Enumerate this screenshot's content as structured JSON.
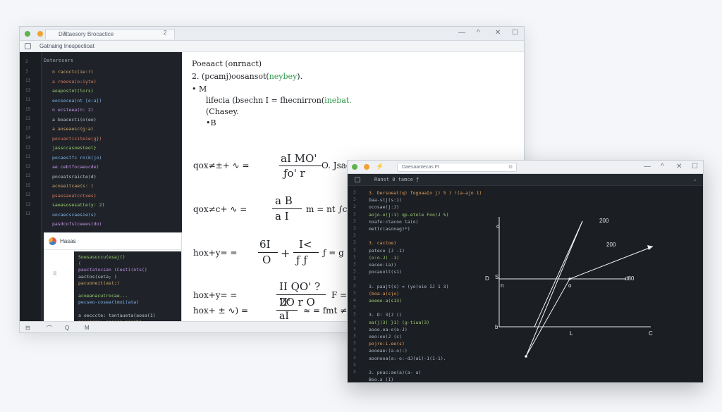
{
  "window1": {
    "tab_title": "Dattaesory Brocactice",
    "tab_close": "x",
    "tab_number": "2",
    "toolbar_text": "Gatnaing Inespectioat",
    "controls": {
      "minimize": "—",
      "restore": "^",
      "close": "✕",
      "maximize": "☐"
    },
    "editor_header": "Daterosers",
    "line_numbers": [
      "2",
      "3",
      "13",
      "13",
      "11",
      "15",
      "13",
      "17",
      "14",
      "13",
      "11",
      "12",
      "13",
      "15",
      "12",
      "13",
      "11"
    ],
    "code_lines": [
      "n racoctc(ie:r)",
      "a roeosa(o:iyte)",
      "aoapostnt(lors)",
      "eocsecea(nt [o:a])",
      "n ecsteea(n: 2)",
      "a boacecti(o(eo)",
      "a aoseaesc(g:a)",
      "pocuacticiteie(g})",
      "jassccasoesteol}",
      "pocaestfc ro(k(jo)",
      "ae cebtfocaeucde)",
      "pnceatsraicte(d)",
      "acoseitcae(s: )",
      "psassaoatcctxes)",
      "saeasosesatte(y: 2)",
      "uocaecscaesie(s)",
      "pasdcofstceees(do)"
    ],
    "notes": {
      "title": "Hasas",
      "side_glyph": "!!!",
      "code_lines": [
        "Soesasuccu(esaj()",
        "(",
        "pauctatocsan (Cesti(nts()",
        "aactos(seta; )",
        "pacuoneit(ast;)",
        "",
        "acoeanacutrocae...",
        "pecseo-cosea(tmoi(ata)",
        "",
        "a oecccte: tantaueta(aosa(1)",
        "psasecan: eaocca asa(b)",
        "aocteae:-ean-aoeae(c(os)",
        "peccsessa(e)",
        "",
        "pc--as-a-icc(o;. a)"
      ]
    },
    "math": {
      "line1": "Poeaact (onrnact)",
      "line2_prefix": "2. (pcamj)oosansot(",
      "line2_green": "neybey",
      "line2_suffix": ").",
      "bullet1": "•   M",
      "line3_prefix": "lifecia (bsechn I = fhecnirron(",
      "line3_green": "inebat.",
      "line4": "(Chasey.",
      "bullet2": "•B",
      "eq1": {
        "lhs": "qox≠±+ ∿ =",
        "num": "aI MO'",
        "den": "ƒo' r",
        "rhs": "O.  Jsacno = (oonyithtoy)."
      },
      "eq2": {
        "lhs": "qox≠c+ ∿ =",
        "num": "a  B",
        "den": "a  I",
        "rhs": "m = nt   ∫c ="
      },
      "eq3": {
        "lhs": "hox+y= =",
        "num": "6I",
        "den": "O",
        "plus": "+",
        "num2": "I<",
        "den2": "ƒ  ƒ",
        "rhs": "ƒ = g = c⁽) ·"
      },
      "eq4": {
        "lhs": "hox+y= =",
        "num": "II  QO' ?",
        "den": "2O  r   O",
        "rhs": "F =c =c"
      },
      "eq5": {
        "lhs": "hox+ ± ∿) =",
        "num": "II'",
        "den": "aI",
        "rhs": "≈ = fmt ≠ecIc"
      }
    },
    "status_icons": [
      "⊟",
      "⌒",
      "Q",
      "M"
    ]
  },
  "window2": {
    "address": "Daesaantecas Ft",
    "address_icon": "⊙",
    "tab_label": "Ranst 0  tamce  ƒ",
    "controls": {
      "minimize": "—",
      "restore": "^",
      "close": "✕",
      "maximize": "☐"
    },
    "line_numbers": [
      "3",
      "3",
      "3",
      "3",
      "3",
      "3",
      "3",
      "3",
      "3",
      "3",
      "3",
      "3",
      "3",
      "3",
      "3",
      "4",
      "3",
      "3",
      "3",
      "3",
      "3",
      "3",
      "3",
      "3",
      "3",
      "3"
    ],
    "code_lines": [
      "3.  Dersoeat(q)  fogoaa[o j) 5 )  !(a-ajo 1)",
      "    Daa-stj(s:1)",
      "    ocosae(j:J)",
      "    aojo-o(j:1)  qp-etole Foo(J %)",
      "    noafo:ctacoo ta(o)",
      "    mettc(asonag)*)",
      "",
      "3.  cactoe)",
      "    pateco [J -1)",
      "    (o:o-J) -1)",
      "    oaceo:ia))",
      "    pocauolt(s1)",
      "",
      "3.  paajt(s) = (yo(oie IJ 1 3)",
      "    (boa-a(sjo)",
      "    aoeeo-a(s13)",
      "",
      "3.  D: 3[J ()",
      "    aa(j(3) }1)  (g-tiua(3)",
      "    aooo.oa-o(o-J)",
      "    oeo:oe(J (c)",
      "    pojro:i.ee(s)",
      "    aooeae:(a-o):)",
      "    aoonooa(a:-o:-dJ(a1)-1(1-1).",
      "",
      "3.  pnac:ae(a)(a- a)",
      "    Boo.a (I)"
    ]
  },
  "chart_data": {
    "type": "line",
    "x_axis_label": "C",
    "y_axis_label": "o",
    "origin_label": "b",
    "left_labels": [
      "D",
      "S",
      "n"
    ],
    "center_label": "o",
    "x_tick_label": "L",
    "series": [
      {
        "name": "200",
        "points": [
          [
            -0.35,
            -0.3
          ],
          [
            0.65,
            1.0
          ]
        ]
      },
      {
        "name": "200",
        "points": [
          [
            -0.35,
            -0.3
          ],
          [
            0.55,
            0.45
          ],
          [
            1.05,
            0.75
          ]
        ]
      }
    ],
    "hline_label": "d80",
    "hline_y": 0.45
  }
}
